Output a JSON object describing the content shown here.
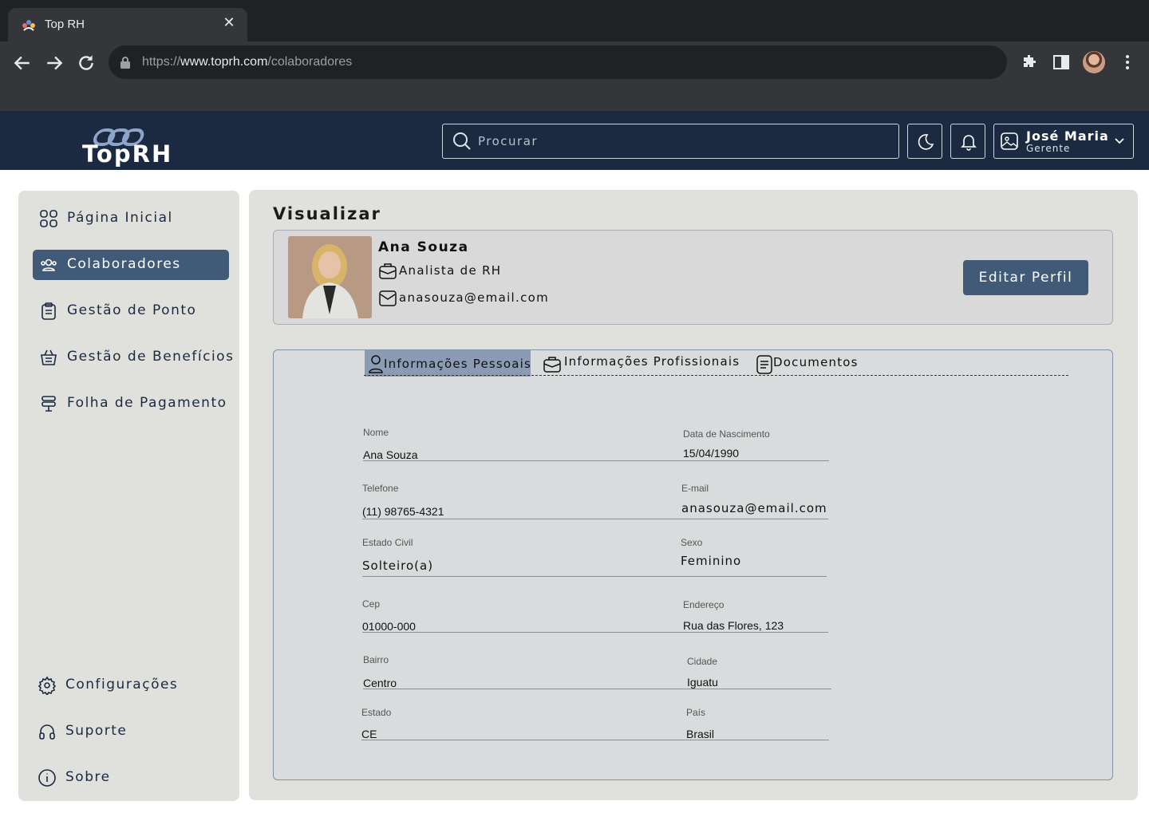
{
  "browser": {
    "tab_title": "Top RH",
    "url_scheme": "https://",
    "url_host": "www.toprh.com",
    "url_path": "/colaboradores"
  },
  "header": {
    "logo_text": "TopRH",
    "search_placeholder": "Procurar",
    "user_name": "José Maria",
    "user_role": "Gerente"
  },
  "sidebar": {
    "items": [
      {
        "label": "Página Inicial",
        "icon": "grid-icon"
      },
      {
        "label": "Colaboradores",
        "icon": "users-icon",
        "active": true
      },
      {
        "label": "Gestão de Ponto",
        "icon": "clipboard-icon"
      },
      {
        "label": "Gestão de Benefícios",
        "icon": "basket-icon"
      },
      {
        "label": "Folha de Pagamento",
        "icon": "payroll-icon"
      }
    ],
    "bottom_items": [
      {
        "label": "Configurações",
        "icon": "gear-icon"
      },
      {
        "label": "Suporte",
        "icon": "headset-icon"
      },
      {
        "label": "Sobre",
        "icon": "info-icon"
      }
    ]
  },
  "main": {
    "title": "Visualizar",
    "profile": {
      "name": "Ana Souza",
      "role": "Analista de RH",
      "email": "anasouza@email.com",
      "edit_label": "Editar Perfil"
    },
    "tabs": [
      {
        "label": "Informações Pessoais",
        "active": true
      },
      {
        "label": "Informações Profissionais"
      },
      {
        "label": "Documentos"
      }
    ],
    "fields": {
      "nome": {
        "label": "Nome",
        "value": "Ana Souza"
      },
      "nascimento": {
        "label": "Data de Nascimento",
        "value": "15/04/1990"
      },
      "telefone": {
        "label": "Telefone",
        "value": "(11) 98765-4321"
      },
      "email": {
        "label": "E-mail",
        "value": "anasouza@email.com"
      },
      "estado_civil": {
        "label": "Estado Civil",
        "value": "Solteiro(a)"
      },
      "sexo": {
        "label": "Sexo",
        "value": "Feminino"
      },
      "cep": {
        "label": "Cep",
        "value": "01000-000"
      },
      "endereco": {
        "label": "Endereço",
        "value": "Rua das Flores, 123"
      },
      "bairro": {
        "label": "Bairro",
        "value": "Centro"
      },
      "cidade": {
        "label": "Cidade",
        "value": "Iguatu"
      },
      "estado": {
        "label": "Estado",
        "value": "CE"
      },
      "pais": {
        "label": "País",
        "value": "Brasil"
      }
    }
  }
}
